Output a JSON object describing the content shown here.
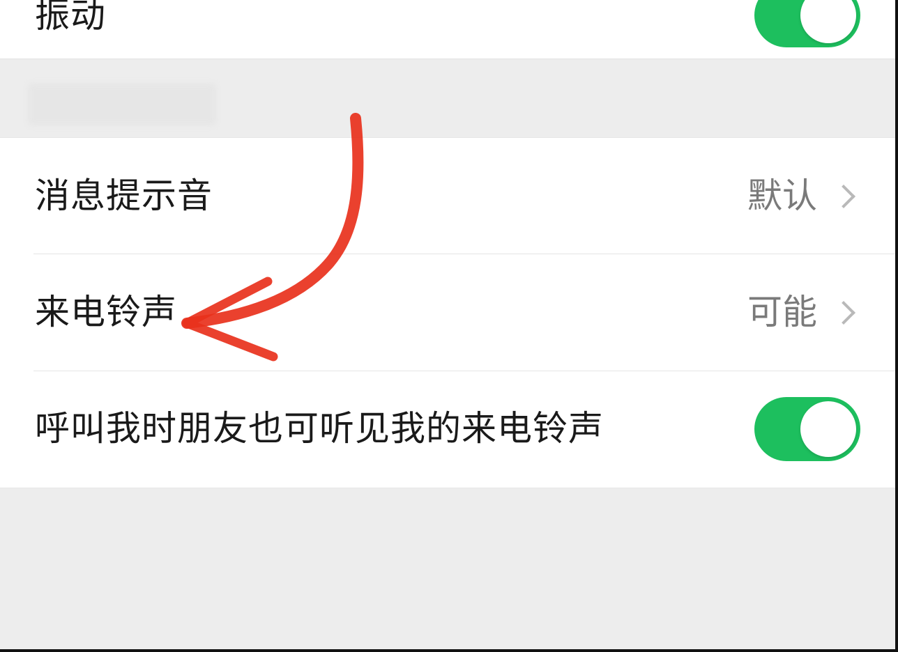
{
  "settings": {
    "vibration": {
      "label": "振动",
      "enabled": true
    },
    "message_tone": {
      "label": "消息提示音",
      "value": "默认"
    },
    "ringtone": {
      "label": "来电铃声",
      "value": "可能"
    },
    "friends_hear_ringtone": {
      "label": "呼叫我时朋友也可听见我的来电铃声",
      "enabled": true
    }
  },
  "colors": {
    "toggle_on": "#1dbf5e",
    "annotation_arrow": "#e8311c",
    "background": "#ededed"
  },
  "icons": {
    "chevron": "chevron-right-icon",
    "annotation": "hand-drawn-arrow-icon"
  }
}
